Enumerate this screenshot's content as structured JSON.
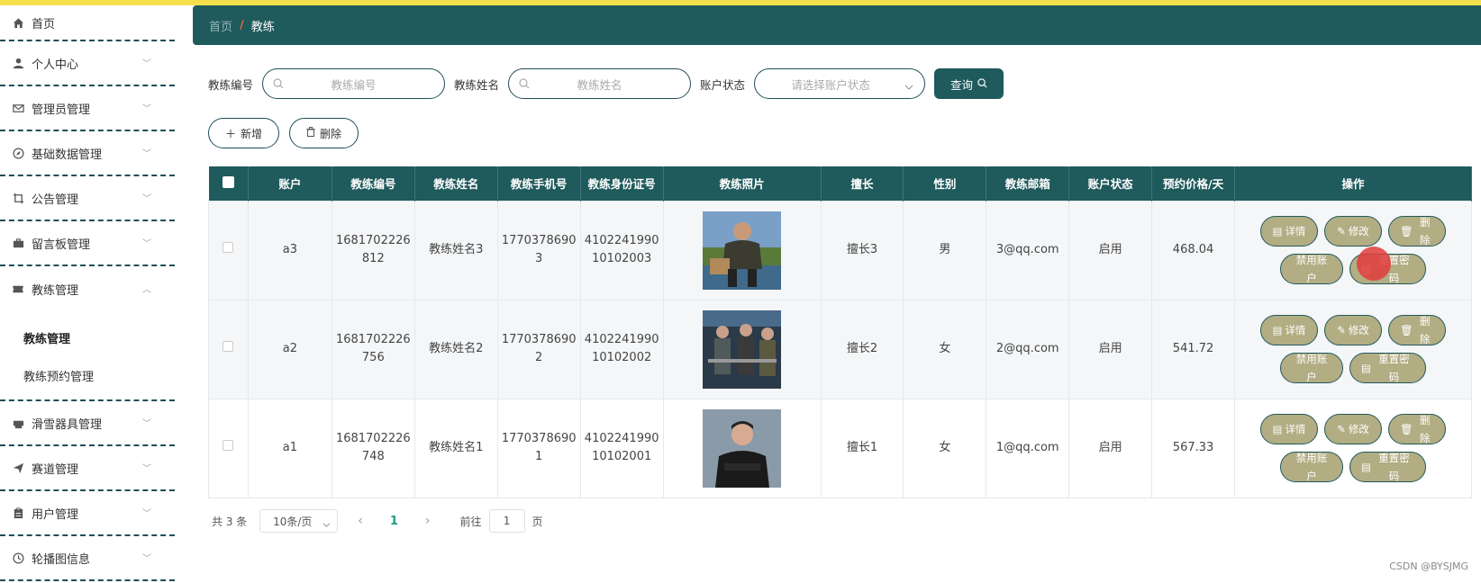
{
  "sidebar": {
    "items": [
      {
        "label": "首页",
        "icon": "home-icon"
      },
      {
        "label": "个人中心",
        "icon": "user-icon"
      },
      {
        "label": "管理员管理",
        "icon": "mail-icon"
      },
      {
        "label": "基础数据管理",
        "icon": "compass-icon"
      },
      {
        "label": "公告管理",
        "icon": "crop-icon"
      },
      {
        "label": "留言板管理",
        "icon": "briefcase-icon"
      },
      {
        "label": "教练管理",
        "icon": "ticket-icon"
      },
      {
        "label": "滑雪器具管理",
        "icon": "printer-icon"
      },
      {
        "label": "赛道管理",
        "icon": "send-icon"
      },
      {
        "label": "用户管理",
        "icon": "clipboard-icon"
      },
      {
        "label": "轮播图信息",
        "icon": "clock-icon"
      }
    ],
    "sub_items": [
      "教练管理",
      "教练预约管理"
    ]
  },
  "breadcrumb": {
    "home": "首页",
    "sep": "/",
    "current": "教练"
  },
  "search": {
    "label_no": "教练编号",
    "placeholder_no": "教练编号",
    "label_name": "教练姓名",
    "placeholder_name": "教练姓名",
    "label_status": "账户状态",
    "placeholder_status": "请选择账户状态",
    "query": "查询"
  },
  "actions": {
    "add": "新增",
    "delete": "删除"
  },
  "table": {
    "headers": [
      "账户",
      "教练编号",
      "教练姓名",
      "教练手机号",
      "教练身份证号",
      "教练照片",
      "擅长",
      "性别",
      "教练邮箱",
      "账户状态",
      "预约价格/天",
      "操作"
    ],
    "rows": [
      {
        "account": "a3",
        "no_1": "1681702226",
        "no_2": "812",
        "name": "教练姓名3",
        "phone_1": "1770378690",
        "phone_2": "3",
        "id_1": "4102241990",
        "id_2": "10102003",
        "skill": "擅长3",
        "gender": "男",
        "email": "3@qq.com",
        "status": "启用",
        "price": "468.04"
      },
      {
        "account": "a2",
        "no_1": "1681702226",
        "no_2": "756",
        "name": "教练姓名2",
        "phone_1": "1770378690",
        "phone_2": "2",
        "id_1": "4102241990",
        "id_2": "10102002",
        "skill": "擅长2",
        "gender": "女",
        "email": "2@qq.com",
        "status": "启用",
        "price": "541.72"
      },
      {
        "account": "a1",
        "no_1": "1681702226",
        "no_2": "748",
        "name": "教练姓名1",
        "phone_1": "1770378690",
        "phone_2": "1",
        "id_1": "4102241990",
        "id_2": "10102001",
        "skill": "擅长1",
        "gender": "女",
        "email": "1@qq.com",
        "status": "启用",
        "price": "567.33"
      }
    ],
    "op_labels": {
      "detail": "详情",
      "edit": "修改",
      "delete": "删除",
      "disable": "禁用账户",
      "reset": "重置密码"
    }
  },
  "pager": {
    "total": "共 3 条",
    "size": "10条/页",
    "current": "1",
    "goto": "前往",
    "goto_value": "1",
    "page": "页"
  },
  "watermark": "CSDN @BYSJMG",
  "colors": {
    "accent": "#1f5a5c",
    "op_button": "#b2ad83",
    "topstrip": "#f4e04d"
  }
}
